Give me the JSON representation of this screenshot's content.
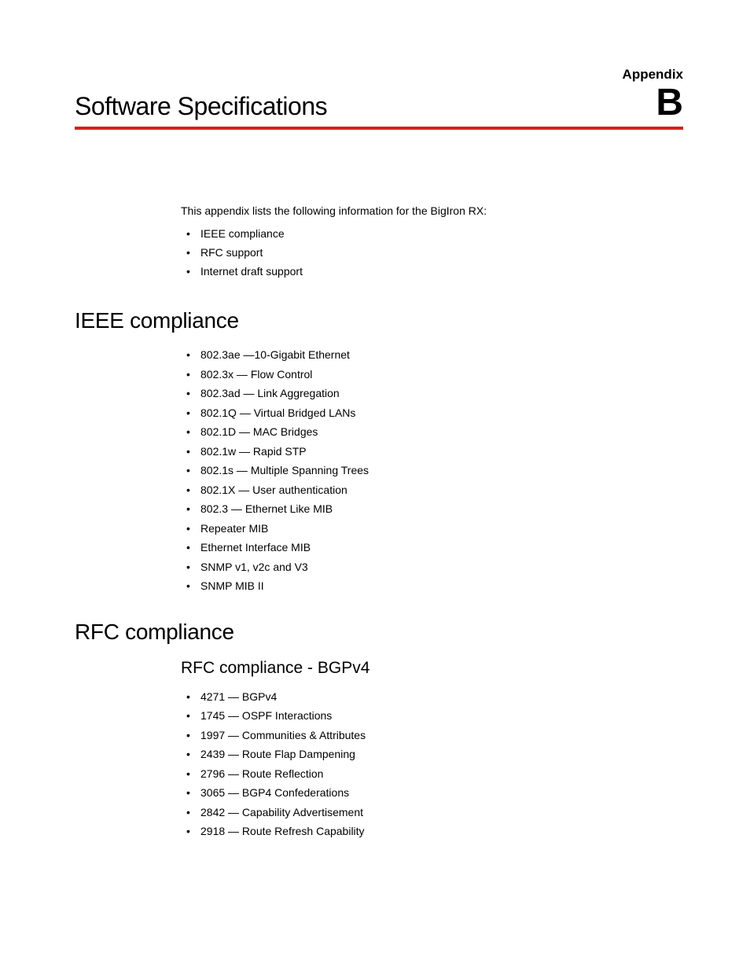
{
  "header": {
    "appendix_label": "Appendix",
    "chapter_title": "Software Specifications",
    "appendix_letter": "B"
  },
  "intro": {
    "text": "This appendix lists the following information for the BigIron RX:",
    "items": [
      "IEEE compliance",
      "RFC support",
      "Internet draft support"
    ]
  },
  "sections": {
    "ieee": {
      "heading": "IEEE compliance",
      "items": [
        "802.3ae —10-Gigabit Ethernet",
        "802.3x — Flow Control",
        "802.3ad — Link Aggregation",
        "802.1Q — Virtual Bridged LANs",
        "802.1D — MAC Bridges",
        "802.1w — Rapid STP",
        "802.1s — Multiple Spanning Trees",
        "802.1X  — User authentication",
        "802.3  — Ethernet Like MIB",
        "Repeater MIB",
        "Ethernet Interface MIB",
        "SNMP v1, v2c and V3",
        "SNMP MIB II"
      ]
    },
    "rfc": {
      "heading": "RFC compliance",
      "bgpv4": {
        "heading": "RFC compliance - BGPv4",
        "items": [
          "4271 — BGPv4",
          "1745 — OSPF Interactions",
          "1997 — Communities & Attributes",
          "2439 — Route Flap Dampening",
          "2796 — Route Reflection",
          "3065 — BGP4 Confederations",
          "2842 — Capability Advertisement",
          "2918 — Route Refresh Capability"
        ]
      }
    }
  }
}
